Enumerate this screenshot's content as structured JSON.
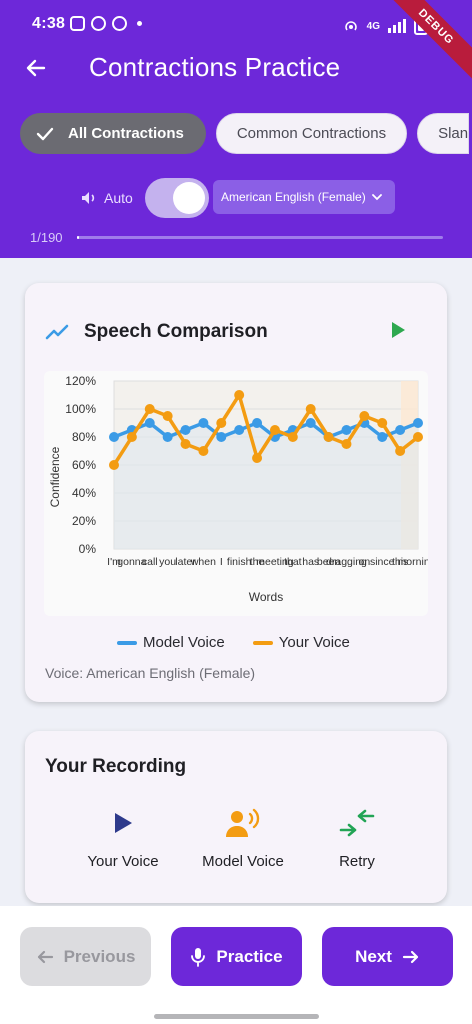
{
  "status_bar": {
    "time": "4:38",
    "network": "4G"
  },
  "debug_banner": "DEBUG",
  "header": {
    "title": "Contractions Practice"
  },
  "categories": [
    {
      "label": "All Contractions",
      "selected": true
    },
    {
      "label": "Common Contractions",
      "selected": false
    },
    {
      "label": "Slang",
      "selected": false
    }
  ],
  "audio_controls": {
    "auto_label": "Auto",
    "auto_enabled": true,
    "voice_selected": "American English (Female)"
  },
  "progress": {
    "text": "1/190",
    "fraction": 0.005
  },
  "speech_card": {
    "title": "Speech Comparison",
    "voice_note": "Voice: American English (Female)"
  },
  "chart_data": {
    "type": "line",
    "xlabel": "Words",
    "ylabel": "Confidence",
    "ylim": [
      0,
      120
    ],
    "yticks": [
      "0%",
      "20%",
      "40%",
      "60%",
      "80%",
      "100%",
      "120%"
    ],
    "categories": [
      "I'm",
      "gonna",
      "call",
      "you",
      "later",
      "when",
      "I",
      "finish",
      "the",
      "meeting",
      "that",
      "has",
      "been",
      "dragging",
      "on",
      "since",
      "this",
      "morning."
    ],
    "xtick_labels": [
      "I'm",
      "gonna",
      "call",
      "you",
      "later",
      "when",
      "I",
      "finish",
      "the",
      "meeting",
      "that",
      "has",
      "been",
      "dragging",
      "on",
      "since",
      "this",
      "morning."
    ],
    "series": [
      {
        "name": "Model Voice",
        "color": "#3b9be6",
        "values": [
          80,
          85,
          90,
          80,
          85,
          90,
          80,
          85,
          90,
          80,
          85,
          90,
          80,
          85,
          90,
          80,
          85,
          90
        ]
      },
      {
        "name": "Your Voice",
        "color": "#f39c12",
        "values": [
          60,
          80,
          100,
          95,
          75,
          70,
          90,
          110,
          65,
          85,
          80,
          100,
          80,
          75,
          95,
          90,
          70,
          80
        ]
      }
    ],
    "grid": true,
    "legend_position": "bottom"
  },
  "recording_card": {
    "title": "Your Recording",
    "actions": [
      {
        "label": "Your Voice",
        "icon": "play-icon",
        "color": "#2e3a8c"
      },
      {
        "label": "Model Voice",
        "icon": "voice-speaker-icon",
        "color": "#f39c12"
      },
      {
        "label": "Retry",
        "icon": "swap-arrows-icon",
        "color": "#22a455"
      }
    ]
  },
  "bottom_nav": {
    "previous_label": "Previous",
    "practice_label": "Practice",
    "next_label": "Next"
  },
  "colors": {
    "primary": "#6d28d9",
    "model_voice": "#3b9be6",
    "your_voice": "#f39c12"
  }
}
